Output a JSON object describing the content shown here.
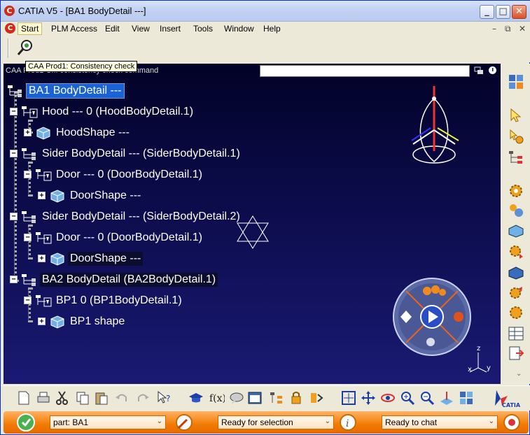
{
  "window": {
    "title": "CATIA V5 - [BA1 BodyDetail ---]",
    "app_icon_letter": "C",
    "controls": {
      "minimize": "_",
      "maximize": "□",
      "close": "✕"
    }
  },
  "menubar": {
    "items": [
      "Start",
      "PLM Access",
      "Edit",
      "View",
      "Insert",
      "Tools",
      "Window",
      "Help"
    ],
    "mdi_controls": [
      "–",
      "⧉",
      "✕"
    ]
  },
  "tooltip": "CAA Prod1: Consistency check",
  "viewer": {
    "command_status": "CAA Prod1 C... consistency check command",
    "search_value": "",
    "tree": [
      {
        "label": "BA1 BodyDetail ---",
        "icon": "product-root-icon",
        "selected": true
      },
      {
        "label": "Hood --- 0 (HoodBodyDetail.1)",
        "icon": "product-icon"
      },
      {
        "label": "HoodShape ---",
        "icon": "part-shape-icon"
      },
      {
        "label": "Sider BodyDetail --- (SiderBodyDetail.1)",
        "icon": "product-root-icon"
      },
      {
        "label": "Door --- 0 (DoorBodyDetail.1)",
        "icon": "product-icon"
      },
      {
        "label": "DoorShape ---",
        "icon": "part-shape-icon"
      },
      {
        "label": "Sider BodyDetail --- (SiderBodyDetail.2)",
        "icon": "product-root-icon"
      },
      {
        "label": "Door --- 0 (DoorBodyDetail.1)",
        "icon": "product-icon"
      },
      {
        "label": "DoorShape ---",
        "icon": "part-shape-icon",
        "hover": true
      },
      {
        "label": "BA2 BodyDetail (BA2BodyDetail.1)",
        "icon": "product-root-icon",
        "hover": true
      },
      {
        "label": "BP1 0 (BP1BodyDetail.1)",
        "icon": "product-icon"
      },
      {
        "label": "BP1 shape",
        "icon": "part-shape-icon"
      }
    ],
    "axis_labels": {
      "x": "x",
      "y": "y",
      "z": "z"
    }
  },
  "statusbar": {
    "part_field": "part: BA1",
    "selection_status": "Ready for selection",
    "chat_status": "Ready to chat"
  },
  "colors": {
    "viewer_top": "#020227",
    "viewer_bottom": "#1a1a73",
    "selection": "#1a63d6",
    "statusbar": "#f27a00"
  }
}
